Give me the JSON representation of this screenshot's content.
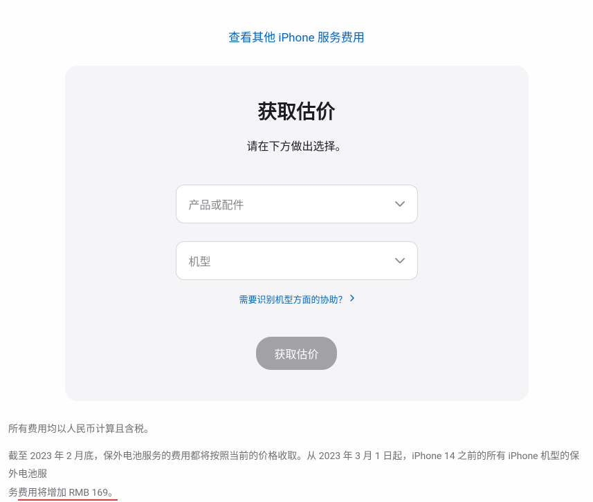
{
  "header": {
    "link_text": "查看其他 iPhone 服务费用"
  },
  "card": {
    "title": "获取估价",
    "subtitle": "请在下方做出选择。",
    "product_placeholder": "产品或配件",
    "model_placeholder": "机型",
    "help_link": "需要识别机型方面的协助？",
    "submit_label": "获取估价"
  },
  "footer": {
    "line1": "所有费用均以人民币计算且含税。",
    "line2_part1": "截至 2023 年 2 月底，保外电池服务的费用都将按照当前的价格收取。从 2023 年 3 月 1 日起，iPhone 14 之前的所有 iPhone 机型的保外电池服",
    "line2_part2": "务",
    "line2_highlight": "费用将增加 RMB 169。"
  }
}
